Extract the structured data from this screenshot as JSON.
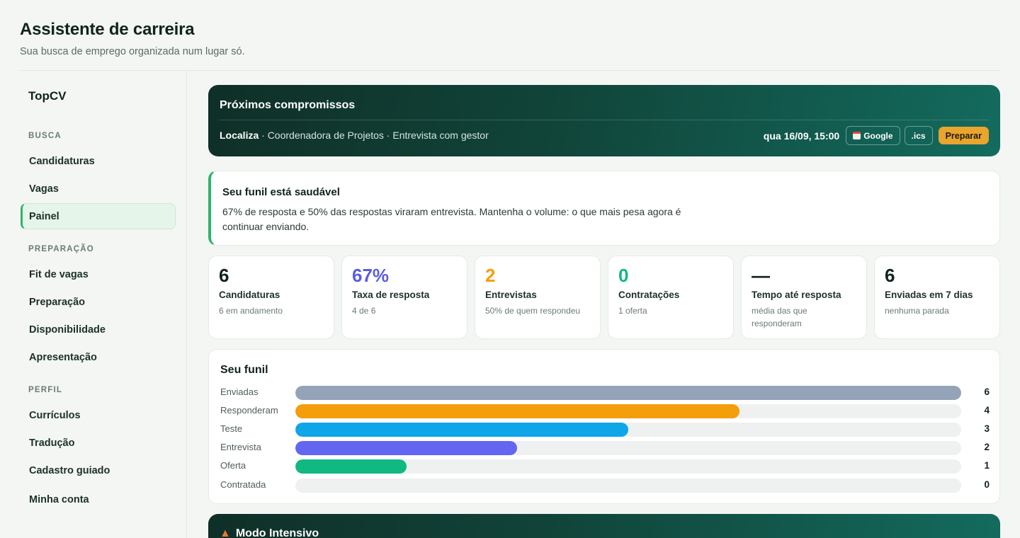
{
  "header": {
    "title": "Assistente de carreira",
    "subtitle": "Sua busca de emprego organizada num lugar só."
  },
  "sidebar": {
    "brand": "TopCV",
    "sections": {
      "busca": "BUSCA",
      "preparacao": "PREPARAÇÃO",
      "perfil": "PERFIL"
    },
    "items": [
      {
        "label": "Candidaturas",
        "active": false
      },
      {
        "label": "Vagas",
        "active": false
      },
      {
        "label": "Painel",
        "active": true
      },
      {
        "label": "Fit de vagas",
        "active": false
      },
      {
        "label": "Preparação",
        "active": false
      },
      {
        "label": "Disponibilidade",
        "active": false
      },
      {
        "label": "Apresentação",
        "active": false
      },
      {
        "label": "Currículos",
        "active": false
      },
      {
        "label": "Tradução",
        "active": false
      },
      {
        "label": "Cadastro guiado",
        "active": false
      },
      {
        "label": "Minha conta",
        "active": false
      }
    ]
  },
  "appointments": {
    "title": "Próximos compromissos",
    "item": {
      "company": "Localiza",
      "details": " · Coordenadora de Projetos · Entrevista com gestor",
      "datetime": "qua 16/09, 15:00",
      "google_label": "Google",
      "ics_label": ".ics",
      "prepare_label": "Preparar"
    }
  },
  "health": {
    "title": "Seu funil está saudável",
    "text": "67% de resposta e 50% das respostas viraram entrevista. Mantenha o volume: o que mais pesa agora é continuar enviando."
  },
  "stats": [
    {
      "value": "6",
      "label": "Candidaturas",
      "sub": "6 em andamento",
      "color": "#10231c"
    },
    {
      "value": "67%",
      "label": "Taxa de resposta",
      "sub": "4 de 6",
      "color": "#5b5ce0"
    },
    {
      "value": "2",
      "label": "Entrevistas",
      "sub": "50% de quem respondeu",
      "color": "#f59e0b"
    },
    {
      "value": "0",
      "label": "Contratações",
      "sub": "1 oferta",
      "color": "#10b981"
    },
    {
      "value": "—",
      "label": "Tempo até resposta",
      "sub": "média das que responderam",
      "color": "#10231c"
    },
    {
      "value": "6",
      "label": "Enviadas em 7 dias",
      "sub": "nenhuma parada",
      "color": "#10231c"
    }
  ],
  "funnel": {
    "title": "Seu funil",
    "max": 6,
    "rows": [
      {
        "label": "Enviadas",
        "value": 6,
        "color": "#94a3b8"
      },
      {
        "label": "Responderam",
        "value": 4,
        "color": "#f59e0b"
      },
      {
        "label": "Teste",
        "value": 3,
        "color": "#0ea5e9"
      },
      {
        "label": "Entrevista",
        "value": 2,
        "color": "#6366f1"
      },
      {
        "label": "Oferta",
        "value": 1,
        "color": "#10b981"
      },
      {
        "label": "Contratada",
        "value": 0,
        "color": "#10b981"
      }
    ]
  },
  "intensive": {
    "title": "Modo Intensivo"
  }
}
